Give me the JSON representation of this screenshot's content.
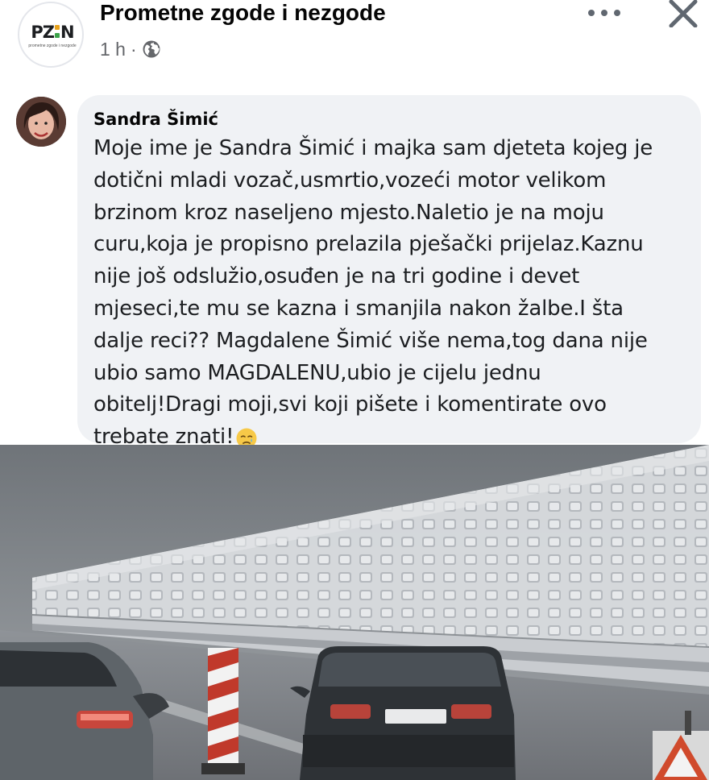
{
  "page": {
    "name": "Prometne zgode i nezgode",
    "logo_text": "PZIN",
    "logo_sub": "prometne zgode i nezgode",
    "time": "1 h",
    "audience_icon": "globe-icon"
  },
  "header_actions": {
    "more_icon": "more-horizontal-icon",
    "close_icon": "close-icon"
  },
  "comment": {
    "author": "Sandra Šimić",
    "lines": [
      "Moje ime je Sandra Šimić i majka sam djeteta kojeg je",
      "dotični mladi vozač,usmrtio,vozeći motor velikom",
      "brzinom kroz naseljeno mjesto.Naletio je na moju",
      "curu,koja je propisno prelazila pješački prijelaz.Kaznu",
      "nije još odslužio,osuđen je na tri godine i devet",
      "mjeseci,te mu se kazna i smanjila nakon žalbe.I šta",
      "dalje reci?? Magdalene Šimić više nema,tog dana nije",
      "ubio samo MAGDALENU,ubio je cijelu jednu",
      "obitelj!Dragi moji,svi koji pišete i komentirate ovo",
      "trebate znati!"
    ],
    "emoji": "sad-face-emoji"
  },
  "photo": {
    "description_icon": "road-photo"
  },
  "colors": {
    "bubble": "#f0f2f5",
    "secondary_text": "#65676b",
    "logo_yellow": "#e8a21c",
    "logo_green": "#3ca34a"
  }
}
